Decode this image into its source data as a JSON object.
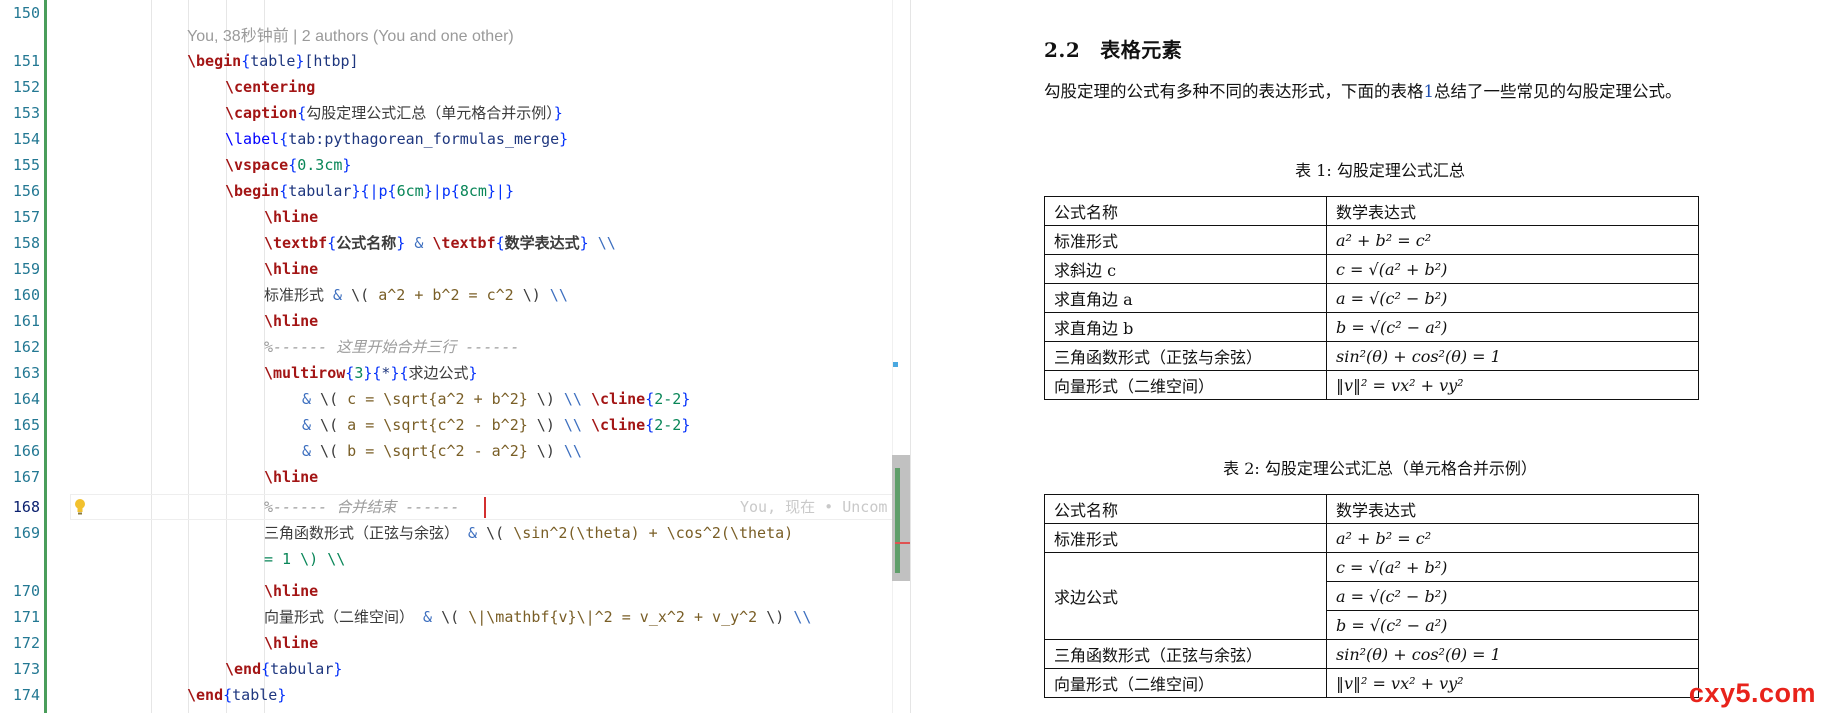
{
  "editor": {
    "blame_hint": "You, 38秒钟前 | 2 authors (You and one other)",
    "inline_blame": "You, 现在 • Uncom",
    "lines": [
      {
        "n": "150"
      },
      {
        "n": "151"
      },
      {
        "n": "152"
      },
      {
        "n": "153"
      },
      {
        "n": "154"
      },
      {
        "n": "155"
      },
      {
        "n": "156"
      },
      {
        "n": "157"
      },
      {
        "n": "158"
      },
      {
        "n": "159"
      },
      {
        "n": "160"
      },
      {
        "n": "161"
      },
      {
        "n": "162"
      },
      {
        "n": "163"
      },
      {
        "n": "164"
      },
      {
        "n": "165"
      },
      {
        "n": "166"
      },
      {
        "n": "167"
      },
      {
        "n": "168"
      },
      {
        "n": "169"
      },
      {
        "n": "170"
      },
      {
        "n": "171"
      },
      {
        "n": "172"
      },
      {
        "n": "173"
      },
      {
        "n": "174"
      }
    ],
    "tokens": {
      "begin": "\\begin",
      "table": "table",
      "htbp": "[htbp]",
      "centering": "\\centering",
      "caption": "\\caption",
      "caption_text": "勾股定理公式汇总（单元格合并示例）",
      "label": "\\label",
      "label_text": "tab:pythagorean_formulas_merge",
      "vspace": "\\vspace",
      "vspace_val": "0.3cm",
      "tabular": "tabular",
      "colspec_a": "{|p{",
      "colspec_b": "6cm",
      "colspec_c": "}|p{",
      "colspec_d": "8cm",
      "colspec_e": "}|}",
      "hline": "\\hline",
      "textbf": "\\textbf",
      "h1": "公式名称",
      "h2": "数学表达式",
      "amp": "&",
      "nl": "\\\\",
      "r1_name": "标准形式",
      "r1_math_a": " \\( ",
      "r1_math_b": "a^2 + b^2 = c^2",
      "r1_math_c": " \\) ",
      "comment1": "%------ 这里开始合并三行 ------",
      "multirow": "\\multirow",
      "mr_3": "3",
      "mr_star": "*",
      "mr_text": "求边公式",
      "sqrt_c": "c = \\sqrt{a^2 + b^2}",
      "sqrt_a": "a = \\sqrt{c^2 - b^2}",
      "sqrt_b": "b = \\sqrt{c^2 - a^2}",
      "cline": "\\cline",
      "cline_arg": "2-2",
      "comment2": "%------ 合并结束 ------",
      "r3_name": "三角函数形式（正弦与余弦）",
      "r3_math": "\\sin^2(\\theta) + \\cos^2(\\theta)",
      "r3_tail": "= 1 \\) \\\\",
      "r4_name": "向量形式（二维空间）",
      "r4_math": "\\|\\mathbf{v}\\|^2 = v_x^2 + v_y^2",
      "end": "\\end"
    }
  },
  "preview": {
    "section_number": "2.2",
    "section_title": "表格元素",
    "paragraph_a": "勾股定理的公式有多种不同的表达形式，下面的表格",
    "paragraph_ref": "1",
    "paragraph_b": "总结了一些常见的勾股定理公式。",
    "table1_caption": "表 1: 勾股定理公式汇总",
    "table2_caption": "表 2: 勾股定理公式汇总（单元格合并示例）",
    "header_name": "公式名称",
    "header_expr": "数学表达式",
    "table1_rows": [
      {
        "name": "标准形式",
        "expr": "a² + b² = c²"
      },
      {
        "name": "求斜边 c",
        "expr": "c = √(a² + b²)"
      },
      {
        "name": "求直角边 a",
        "expr": "a = √(c² − b²)"
      },
      {
        "name": "求直角边 b",
        "expr": "b = √(c² − a²)"
      },
      {
        "name": "三角函数形式（正弦与余弦）",
        "expr": "sin²(θ) + cos²(θ) = 1"
      },
      {
        "name": "向量形式（二维空间）",
        "expr": "‖v‖² = vx² + vy²"
      }
    ],
    "table2": {
      "standard_name": "标准形式",
      "standard_expr": "a² + b² = c²",
      "merged_name": "求边公式",
      "merged_exprs": [
        "c = √(a² + b²)",
        "a = √(c² − b²)",
        "b = √(c² − a²)"
      ],
      "trig_name": "三角函数形式（正弦与余弦）",
      "trig_expr": "sin²(θ) + cos²(θ) = 1",
      "vector_name": "向量形式（二维空间）",
      "vector_expr": "‖v‖² = vx² + vy²"
    },
    "watermark": "cxy5.com"
  },
  "colors": {
    "gutter_modified": "#4a9d5b",
    "keyword": "#a31515",
    "brace": "#0431fa",
    "link": "#1f4fb0",
    "watermark": "#e8231b"
  }
}
